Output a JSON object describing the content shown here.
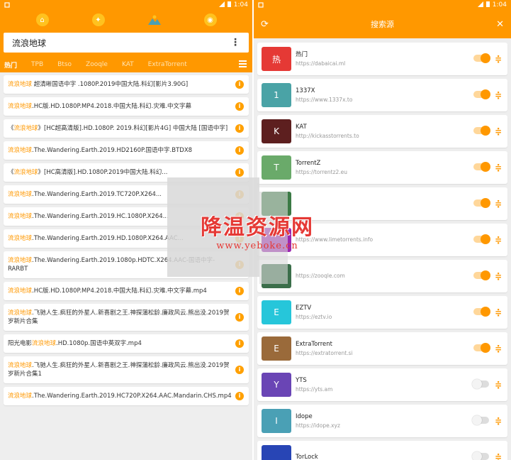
{
  "left": {
    "status": {
      "time": "1:04"
    },
    "top_icons": [
      "home-icon",
      "compass-icon",
      "mountain-icon",
      "rss-icon"
    ],
    "search": {
      "value": "流浪地球"
    },
    "tabs": [
      "热门",
      "TPB",
      "Btso",
      "Zooqle",
      "KAT",
      "ExtraTorrent"
    ],
    "results": [
      {
        "hl": "流浪地球",
        "rest": " 超清晰国语中字 .1080P.2019中国大陆.科幻[影片3.90G]"
      },
      {
        "hl": "流浪地球",
        "rest": ".HC版.HD.1080P.MP4.2018.中国大陆.科幻.灾难.中文字幕"
      },
      {
        "pre": "《",
        "hl": "流浪地球",
        "rest": "》[HC超高清版].HD.1080P. 2019.科幻[影片4G] 中国大陆 [国语中字]"
      },
      {
        "hl": "流浪地球",
        "rest": ".The.Wandering.Earth.2019.HD2160P.国语中字.BTDX8"
      },
      {
        "pre": "《",
        "hl": "流浪地球",
        "rest": "》[HC高清版].HD.1080P.2019中国大陆.科幻..."
      },
      {
        "hl": "流浪地球",
        "rest": ".The.Wandering.Earth.2019.TC720P.X264..."
      },
      {
        "hl": "流浪地球",
        "rest": ".The.Wandering.Earth.2019.HC.1080P.X264..."
      },
      {
        "hl": "流浪地球",
        "rest": ".The.Wandering.Earth.2019.HD.1080P.X264.AAC..."
      },
      {
        "hl": "流浪地球",
        "rest": ".The.Wandering.Earth.2019.1080p.HDTC.X264.AAC-国语中字-RARBT"
      },
      {
        "hl": "流浪地球",
        "rest": ".HC版.HD.1080P.MP4.2018.中国大陆.科幻.灾难.中文字幕.mp4"
      },
      {
        "hl": "流浪地球",
        "rest": ".飞驰人生.疯狂的外星人.新喜剧之王.神探蒲松龄.廉政风云.熊出没.2019贺岁新片合集"
      },
      {
        "pre": "阳光电影",
        "hl": "流浪地球",
        "rest": ".HD.1080p.国语中英双字.mp4"
      },
      {
        "hl": "流浪地球",
        "rest": ".飞驰人生.疯狂的外星人.新喜剧之王.神探蒲松龄.廉政风云.熊出没.2019贺岁新片合集1"
      },
      {
        "hl": "流浪地球",
        "rest": ".The.Wandering.Earth.2019.HC720P.X264.AAC.Mandarin.CHS.mp4"
      }
    ]
  },
  "right": {
    "status": {
      "time": "1:04"
    },
    "title": "搜索源",
    "sources": [
      {
        "letter": "热",
        "color": "#e53935",
        "name": "热门",
        "url": "https://dabaicai.ml",
        "on": true
      },
      {
        "letter": "1",
        "color": "#4aa3a6",
        "name": "1337X",
        "url": "https://www.1337x.to",
        "on": true
      },
      {
        "letter": "K",
        "color": "#5d1f1f",
        "name": "KAT",
        "url": "http://kickasstorrents.to",
        "on": true
      },
      {
        "letter": "T",
        "color": "#6aaa6a",
        "name": "TorrentZ",
        "url": "https://torrentz2.eu",
        "on": true
      },
      {
        "letter": "",
        "color": "#3b7a45",
        "name": "",
        "url": "",
        "on": true
      },
      {
        "letter": "",
        "color": "#9c27b0",
        "name": "",
        "url": "https://www.limetorrents.info",
        "on": true
      },
      {
        "letter": "",
        "color": "#3b6e4a",
        "name": "",
        "url": "https://zooqle.com",
        "on": true
      },
      {
        "letter": "E",
        "color": "#26c6da",
        "name": "EZTV",
        "url": "https://eztv.io",
        "on": true
      },
      {
        "letter": "E",
        "color": "#9a6a3a",
        "name": "ExtraTorrent",
        "url": "https://extratorrent.si",
        "on": true
      },
      {
        "letter": "Y",
        "color": "#6a45b5",
        "name": "YTS",
        "url": "https://yts.am",
        "on": false
      },
      {
        "letter": "I",
        "color": "#4aa0b5",
        "name": "Idope",
        "url": "https://idope.xyz",
        "on": false
      },
      {
        "letter": "",
        "color": "#2845b5",
        "name": "TorLock",
        "url": "",
        "on": false
      }
    ]
  },
  "watermark": {
    "main": "降温资源网",
    "sub": "www.yeboke.cn"
  },
  "colors": {
    "primary": "#ff9800",
    "highlight": "#ff9800"
  }
}
